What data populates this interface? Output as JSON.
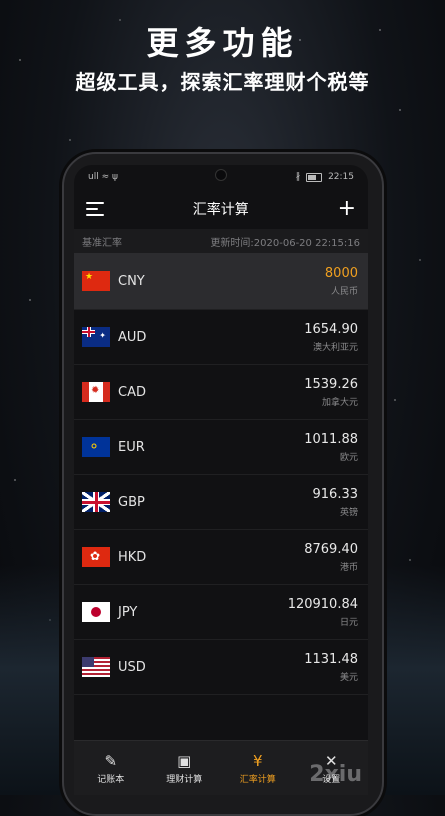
{
  "promo": {
    "headline": "更多功能",
    "subline": "超级工具，探索汇率理财个税等"
  },
  "status_bar": {
    "left_icons": "ull ≈ ψ",
    "time": "22:15",
    "bluetooth": "∦"
  },
  "app_bar": {
    "title": "汇率计算",
    "add": "+"
  },
  "base_row": {
    "label": "基准汇率",
    "updated": "更新时间:2020-06-20 22:15:16"
  },
  "currencies": [
    {
      "code": "CNY",
      "amount": "8000",
      "name": "人民币",
      "flag": "cn-flag-icon",
      "active": true
    },
    {
      "code": "AUD",
      "amount": "1654.90",
      "name": "澳大利亚元",
      "flag": "au-flag-icon"
    },
    {
      "code": "CAD",
      "amount": "1539.26",
      "name": "加拿大元",
      "flag": "ca-flag-icon"
    },
    {
      "code": "EUR",
      "amount": "1011.88",
      "name": "欧元",
      "flag": "eu-flag-icon"
    },
    {
      "code": "GBP",
      "amount": "916.33",
      "name": "英镑",
      "flag": "gb-flag-icon"
    },
    {
      "code": "HKD",
      "amount": "8769.40",
      "name": "港币",
      "flag": "hk-flag-icon"
    },
    {
      "code": "JPY",
      "amount": "120910.84",
      "name": "日元",
      "flag": "jp-flag-icon"
    },
    {
      "code": "USD",
      "amount": "1131.48",
      "name": "美元",
      "flag": "us-flag-icon"
    }
  ],
  "tabs": [
    {
      "label": "记账本",
      "icon": "edit-icon",
      "glyph": "✎"
    },
    {
      "label": "理财计算",
      "icon": "banknote-icon",
      "glyph": "▣"
    },
    {
      "label": "汇率计算",
      "icon": "yen-icon",
      "glyph": "¥",
      "active": true
    },
    {
      "label": "设置",
      "icon": "wrench-icon",
      "glyph": "✕"
    }
  ],
  "watermark": "2xiu",
  "colors": {
    "accent": "#f0a020",
    "background": "#111113",
    "active_row": "#2c2c2f"
  }
}
